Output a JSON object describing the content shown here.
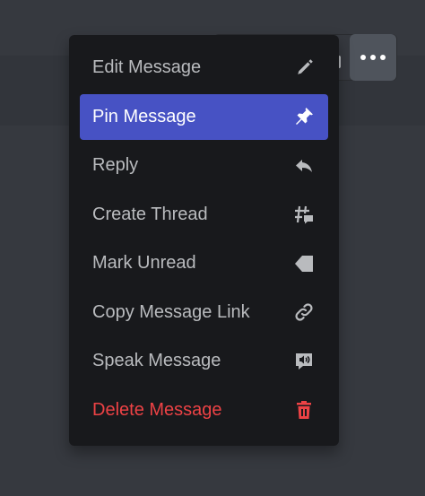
{
  "menu": {
    "items": [
      {
        "label": "Edit Message",
        "icon": "pencil-icon"
      },
      {
        "label": "Pin Message",
        "icon": "pin-icon",
        "highlighted": true
      },
      {
        "label": "Reply",
        "icon": "reply-arrow-icon"
      },
      {
        "label": "Create Thread",
        "icon": "thread-icon"
      },
      {
        "label": "Mark Unread",
        "icon": "flag-icon"
      },
      {
        "label": "Copy Message Link",
        "icon": "link-icon"
      },
      {
        "label": "Speak Message",
        "icon": "speaker-bubble-icon"
      },
      {
        "label": "Delete Message",
        "icon": "trash-icon",
        "danger": true
      }
    ]
  },
  "colors": {
    "background": "#36393f",
    "menu_background": "#18191c",
    "highlight": "#4752c4",
    "text": "#b9bbbe",
    "danger": "#ed4245"
  }
}
